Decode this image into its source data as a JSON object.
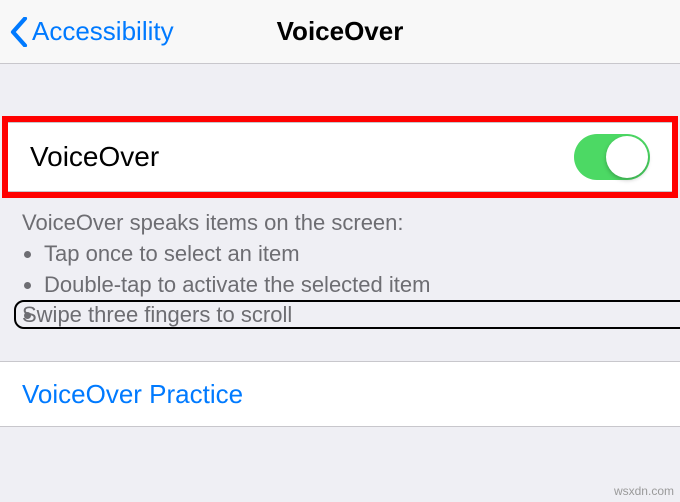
{
  "nav": {
    "back_label": "Accessibility",
    "title": "VoiceOver"
  },
  "main_toggle": {
    "label": "VoiceOver",
    "on": true
  },
  "description": {
    "heading": "VoiceOver speaks items on the screen:",
    "bullets": [
      "Tap once to select an item",
      "Double-tap to activate the selected item",
      "Swipe three fingers to scroll"
    ]
  },
  "practice": {
    "label": "VoiceOver Practice"
  },
  "watermark": "wsxdn.com"
}
